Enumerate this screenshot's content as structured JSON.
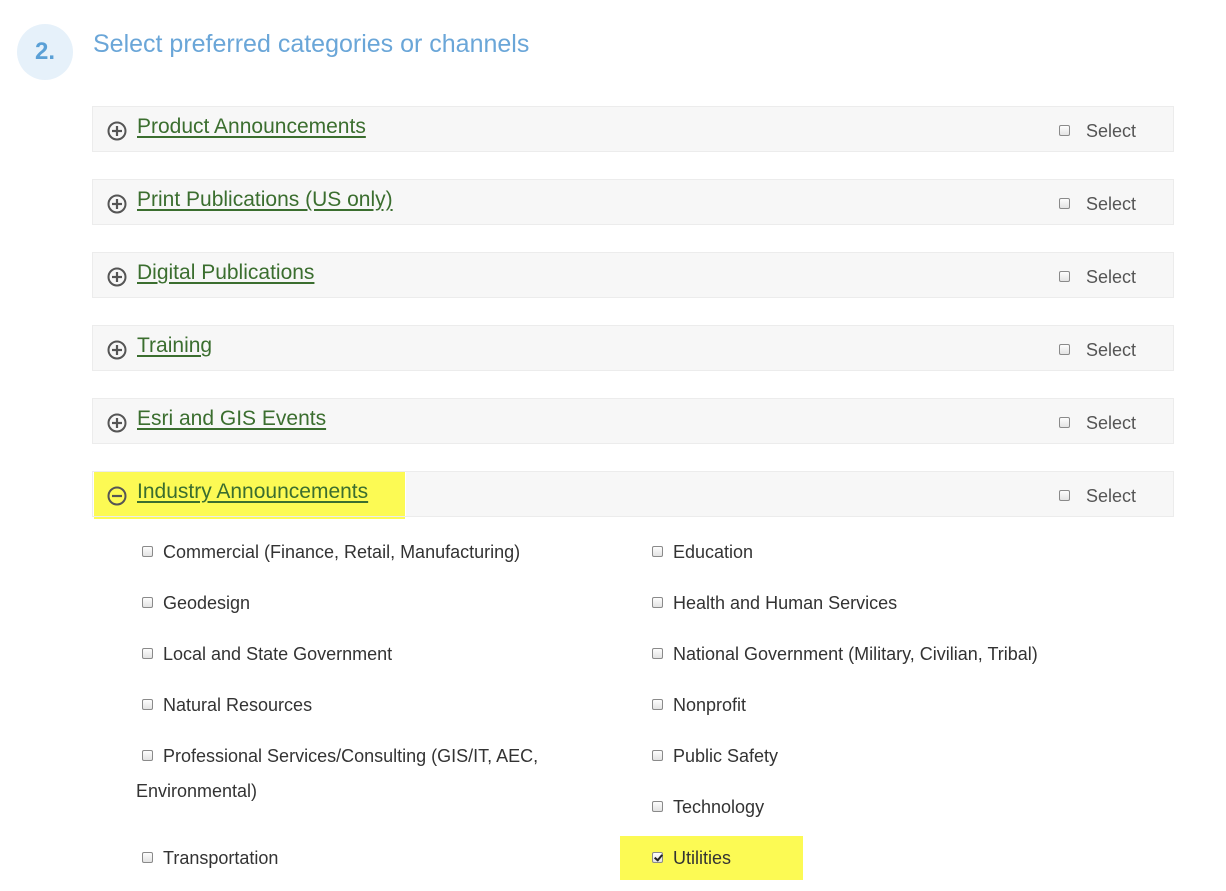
{
  "step": {
    "number": "2.",
    "title": "Select preferred categories or channels"
  },
  "categories": [
    {
      "title": "Product Announcements",
      "select_label": "Select",
      "expanded": false,
      "checked": false
    },
    {
      "title": "Print Publications (US only)",
      "select_label": "Select",
      "expanded": false,
      "checked": false
    },
    {
      "title": "Digital Publications",
      "select_label": "Select",
      "expanded": false,
      "checked": false
    },
    {
      "title": "Training",
      "select_label": "Select",
      "expanded": false,
      "checked": false
    },
    {
      "title": "Esri and GIS Events",
      "select_label": "Select",
      "expanded": false,
      "checked": false
    },
    {
      "title": "Industry Announcements",
      "select_label": "Select",
      "expanded": true,
      "checked": false
    }
  ],
  "industry_items": {
    "left": [
      {
        "label": "Commercial (Finance, Retail, Manufacturing)",
        "checked": false
      },
      {
        "label": "Geodesign",
        "checked": false
      },
      {
        "label": "Local and State Government",
        "checked": false
      },
      {
        "label": "Natural Resources",
        "checked": false
      },
      {
        "label": "Professional Services/Consulting (GIS/IT, AEC,",
        "label_cont": "Environmental)",
        "checked": false
      },
      {
        "label": "Transportation",
        "checked": false
      }
    ],
    "right": [
      {
        "label": "Education",
        "checked": false
      },
      {
        "label": "Health and Human Services",
        "checked": false
      },
      {
        "label": "National Government (Military, Civilian, Tribal)",
        "checked": false
      },
      {
        "label": "Nonprofit",
        "checked": false
      },
      {
        "label": "Public Safety",
        "checked": false
      },
      {
        "label": "Technology",
        "checked": false
      },
      {
        "label": "Utilities",
        "checked": true
      }
    ]
  },
  "colors": {
    "accent": "#6aa6d8",
    "link": "#3b6e2f",
    "highlight": "#fcfa54",
    "row_bg": "#f7f7f7"
  },
  "icons": {
    "collapsed": "plus-circle-icon",
    "expanded": "minus-circle-icon"
  }
}
